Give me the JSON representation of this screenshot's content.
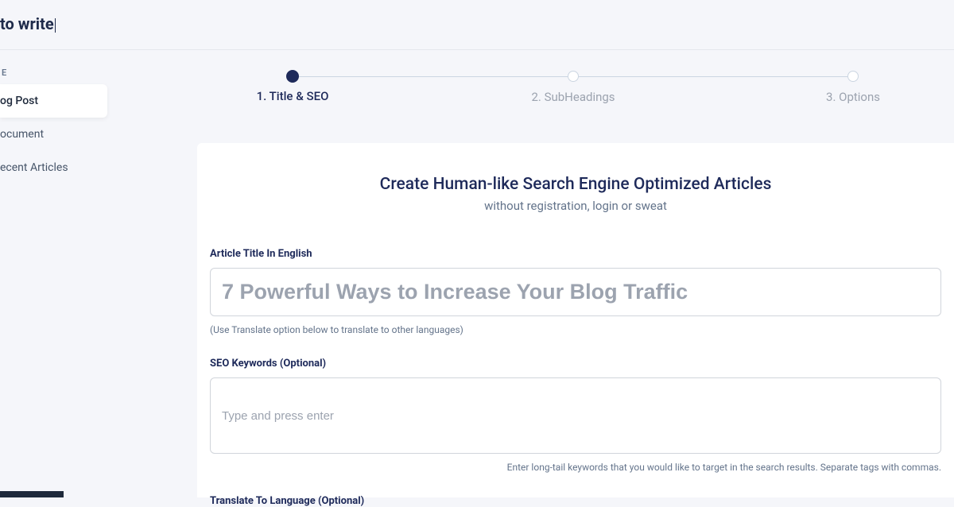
{
  "header": {
    "title_fragment": "to write"
  },
  "sidebar": {
    "section_label": "E",
    "items": [
      {
        "label": "og Post",
        "active": true
      },
      {
        "label": "ocument",
        "active": false
      },
      {
        "label": "ecent Articles",
        "active": false
      }
    ]
  },
  "stepper": {
    "steps": [
      {
        "label": "1. Title & SEO",
        "active": true
      },
      {
        "label": "2. SubHeadings",
        "active": false
      },
      {
        "label": "3. Options",
        "active": false
      }
    ]
  },
  "card": {
    "title": "Create Human-like Search Engine Optimized Articles",
    "subtitle": "without registration, login or sweat"
  },
  "fields": {
    "article_title": {
      "label": "Article Title In English",
      "placeholder": "7 Powerful Ways to Increase Your Blog Traffic",
      "hint": "(Use Translate option below to translate to other languages)"
    },
    "seo_keywords": {
      "label": "SEO Keywords (Optional)",
      "placeholder": "Type and press enter",
      "hint": "Enter long-tail keywords that you would like to target in the search results. Separate tags with commas."
    },
    "translate": {
      "label": "Translate To Language (Optional)"
    }
  }
}
